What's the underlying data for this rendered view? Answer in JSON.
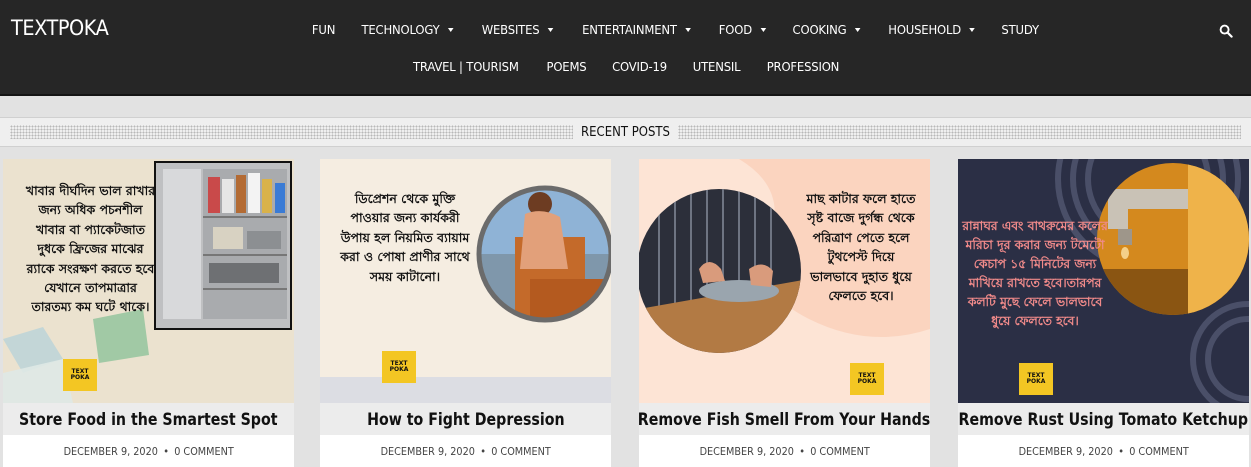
{
  "header": {
    "logo": "TEXTPOKA",
    "nav_row1": [
      {
        "label": "FUN",
        "dropdown": false
      },
      {
        "label": "TECHNOLOGY",
        "dropdown": true
      },
      {
        "label": "WEBSITES",
        "dropdown": true
      },
      {
        "label": "ENTERTAINMENT",
        "dropdown": true
      },
      {
        "label": "FOOD",
        "dropdown": true
      },
      {
        "label": "COOKING",
        "dropdown": true
      },
      {
        "label": "HOUSEHOLD",
        "dropdown": true
      },
      {
        "label": "STUDY",
        "dropdown": false
      }
    ],
    "nav_row2": [
      {
        "label": "TRAVEL | TOURISM",
        "dropdown": false
      },
      {
        "label": "POEMS",
        "dropdown": false
      },
      {
        "label": "COVID-19",
        "dropdown": false
      },
      {
        "label": "UTENSIL",
        "dropdown": false
      },
      {
        "label": "PROFESSION",
        "dropdown": false
      }
    ],
    "search_icon": "search-icon"
  },
  "section": {
    "title": "RECENT POSTS"
  },
  "posts": [
    {
      "title": "Store Food in the Smartest Spot",
      "date": "DECEMBER 9, 2020",
      "comments": "0 COMMENT",
      "image_text": "খাবার দীর্ঘদিন ভাল রাখার জন্য অধিক পচনশীল খাবার বা প্যাকেটজাত দুধকে ফ্রিজের মাঝের র‍্যাকে সংরক্ষণ করতে হবে যেখানে তাপমাত্রার তারতম্য কম ঘটে থাকে।",
      "badge": "TEXT POKA"
    },
    {
      "title": "How to Fight Depression",
      "date": "DECEMBER 9, 2020",
      "comments": "0 COMMENT",
      "image_text": "ডিপ্রেশন থেকে মুক্তি পাওয়ার জন্য কার্যকরী উপায় হল নিয়মিত ব্যায়াম করা ও পোষা প্রাণীর সাথে সময় কাটানো।",
      "badge": "TEXT POKA"
    },
    {
      "title": "Remove Fish Smell From Your Hands",
      "date": "DECEMBER 9, 2020",
      "comments": "0 COMMENT",
      "image_text": "মাছ কাটার ফলে হাতে সৃষ্ট বাজে দুর্গন্ধ থেকে পরিত্রাণ পেতে হলে টুথপেস্ট দিয়ে ভালভাবে দুহাত ধুয়ে ফেলতে হবে।",
      "badge": "TEXT POKA"
    },
    {
      "title": "Remove Rust Using Tomato Ketchup",
      "date": "DECEMBER 9, 2020",
      "comments": "0 COMMENT",
      "image_text": "রান্নাঘর এবং বাথরুমের কলের মরিচা দূর করার জন্য টমেটো কেচাপ ১৫ মিনিটের জন্য মাখিয়ে রাখতে হবে।তারপর কলটি মুছে ফেলে ভালভাবে ধুয়ে ফেলতে হবে।",
      "badge": "TEXT POKA"
    }
  ],
  "colors": {
    "header_bg": "#262626",
    "page_bg": "#e2e2e2",
    "title_bar": "#ececec",
    "badge": "#f3c623",
    "rust_text": "#f08a8a"
  }
}
